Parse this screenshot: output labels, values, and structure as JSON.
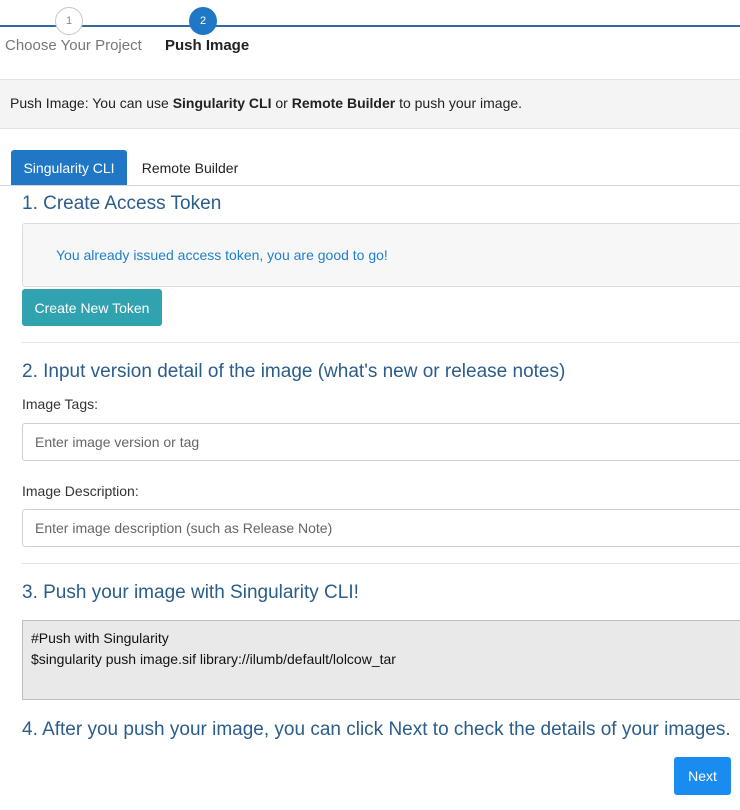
{
  "stepper": {
    "steps": [
      {
        "number": "1",
        "label": "Choose Your Project"
      },
      {
        "number": "2",
        "label": "Push Image"
      }
    ]
  },
  "info_bar": {
    "prefix": "Push Image: You can use ",
    "option1": "Singularity CLI",
    "or": " or ",
    "option2": "Remote Builder",
    "suffix": " to push your image."
  },
  "tabs": [
    {
      "label": "Singularity CLI"
    },
    {
      "label": "Remote Builder"
    }
  ],
  "section1": {
    "title": "1. Create Access Token",
    "alert": "You already issued access token, you are good to go!",
    "button_label": "Create New Token"
  },
  "section2": {
    "title": "2. Input version detail of the image (what's new or release notes)",
    "tags_label": "Image Tags:",
    "tags_placeholder": "Enter image version or tag",
    "description_label": "Image Description:",
    "description_placeholder": "Enter image description (such as Release Note)"
  },
  "section3": {
    "title": "3. Push your image with Singularity CLI!",
    "code_line1": "#Push with Singularity",
    "code_line2": "$singularity push image.sif library://ilumb/default/lolcow_tar"
  },
  "section4": {
    "title": "4. After you push your image, you can click Next to check the details of your images."
  },
  "next_button": "Next",
  "colors": {
    "accent": "#1f77c5",
    "heading": "#2b5d8b",
    "token_button": "#31a2b0",
    "next_button": "#1a8cf0"
  }
}
